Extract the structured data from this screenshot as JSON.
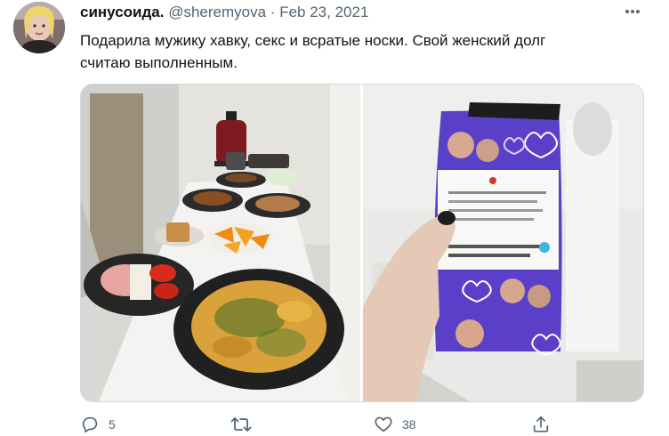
{
  "tweet": {
    "author_name": "синусоида.",
    "handle": "@sheremyova",
    "separator": "·",
    "date": "Feb 23, 2021",
    "text_line1": "Подарила мужику хавку, секс и всратые носки. Свой женский долг",
    "text_line2": "считаю выполненным."
  },
  "media": [
    {
      "icon": "food-table-photo"
    },
    {
      "icon": "socks-gift-photo"
    }
  ],
  "actions": {
    "reply_count": "5",
    "retweet_count": "",
    "like_count": "38"
  },
  "colors": {
    "text": "#0f1419",
    "secondary": "#536471",
    "border": "#cfd9de",
    "sock_purple": "#5a3fc8"
  }
}
